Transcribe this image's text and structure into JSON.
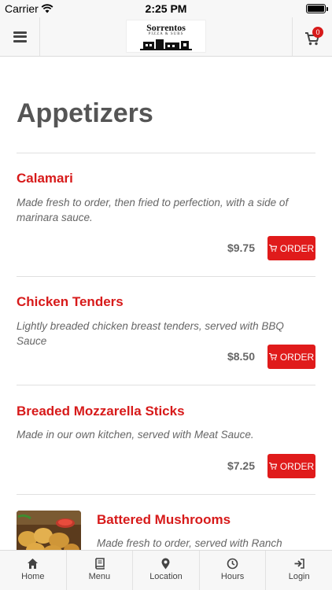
{
  "status_bar": {
    "carrier": "Carrier",
    "time": "2:25 PM"
  },
  "header": {
    "logo": {
      "name": "Sorrentos",
      "tagline": "PIZZA & SUBS"
    },
    "cart_count": "0"
  },
  "menu": {
    "section_title": "Appetizers",
    "items": [
      {
        "name": "Calamari",
        "description": "Made fresh to order, then fried to perfection, with a side of marinara sauce.",
        "price": "$9.75",
        "order_label": "ORDER"
      },
      {
        "name": "Chicken Tenders",
        "description": "Lightly breaded chicken breast tenders, served with BBQ Sauce",
        "price": "$8.50",
        "order_label": "ORDER"
      },
      {
        "name": "Breaded Mozzarella Sticks",
        "description": "Made in our own kitchen, served with Meat Sauce.",
        "price": "$7.25",
        "order_label": "ORDER"
      },
      {
        "name": "Battered Mushrooms",
        "description": "Made fresh to order, served with Ranch"
      }
    ]
  },
  "tabs": [
    {
      "label": "Home",
      "icon": "home-icon"
    },
    {
      "label": "Menu",
      "icon": "book-icon"
    },
    {
      "label": "Location",
      "icon": "map-pin-icon"
    },
    {
      "label": "Hours",
      "icon": "clock-icon"
    },
    {
      "label": "Login",
      "icon": "login-icon"
    }
  ],
  "colors": {
    "accent": "#e01b1b",
    "item_name": "#d71a1a",
    "bar_bg": "#f7f7f7"
  }
}
